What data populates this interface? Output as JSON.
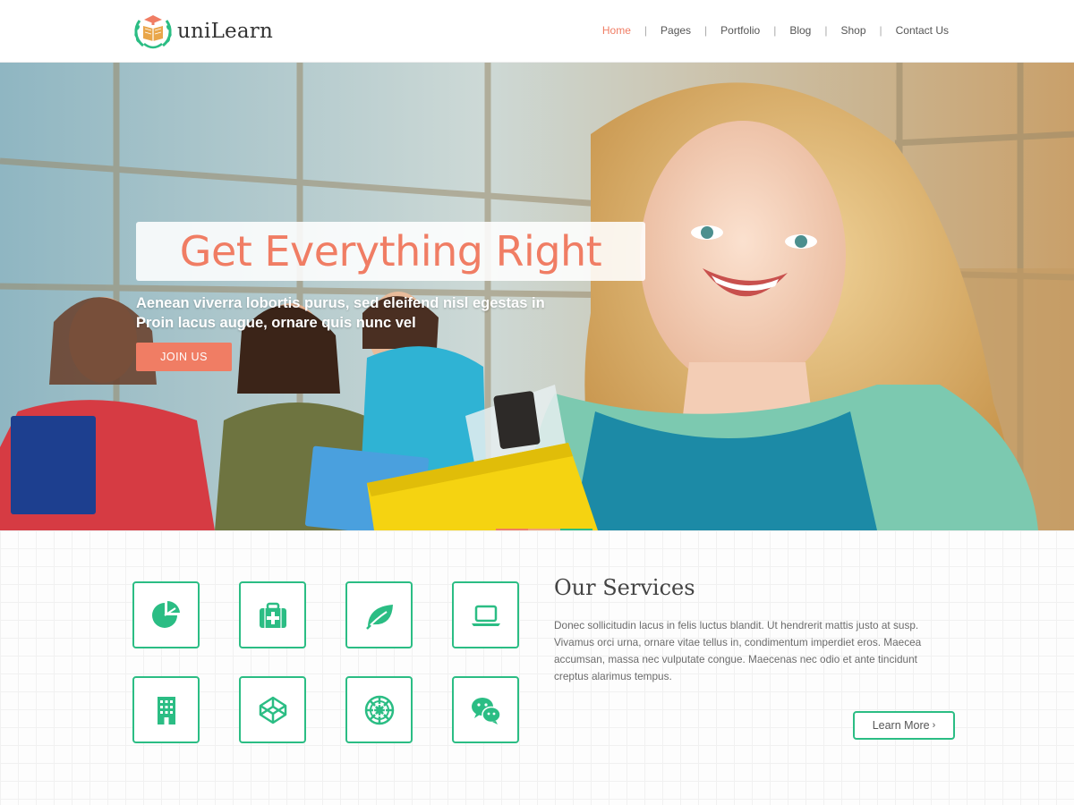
{
  "brand": {
    "name": "uniLearn"
  },
  "nav": {
    "items": [
      {
        "label": "Home",
        "active": true
      },
      {
        "label": "Pages",
        "active": false
      },
      {
        "label": "Portfolio",
        "active": false
      },
      {
        "label": "Blog",
        "active": false
      },
      {
        "label": "Shop",
        "active": false
      },
      {
        "label": "Contact Us",
        "active": false
      }
    ],
    "separator": "|"
  },
  "hero": {
    "title": "Get Everything Right",
    "subtitle": "Aenean viverra lobortis purus, sed eleifend nisl egestas in Proin lacus augue, ornare quis nunc vel",
    "cta_label": "JOIN US",
    "slider_dots": [
      "#f07d64",
      "#f0a07a",
      "#2bbd84"
    ]
  },
  "services": {
    "title": "Our Services",
    "description": "Donec sollicitudin lacus in felis luctus blandit. Ut hendrerit mattis justo at susp. Vivamus orci urna, ornare vitae tellus in, condimentum imperdiet eros. Maecea accumsan, massa nec vulputate congue. Maecenas nec odio et ante tincidunt creptus alarimus tempus.",
    "learn_more_label": "Learn More",
    "icons": [
      "pie-chart-icon",
      "medkit-icon",
      "leaf-icon",
      "laptop-icon",
      "building-icon",
      "codepen-icon",
      "empire-icon",
      "wechat-icon"
    ]
  },
  "colors": {
    "accent": "#f07d64",
    "green": "#2bbd84",
    "text": "#555555"
  }
}
